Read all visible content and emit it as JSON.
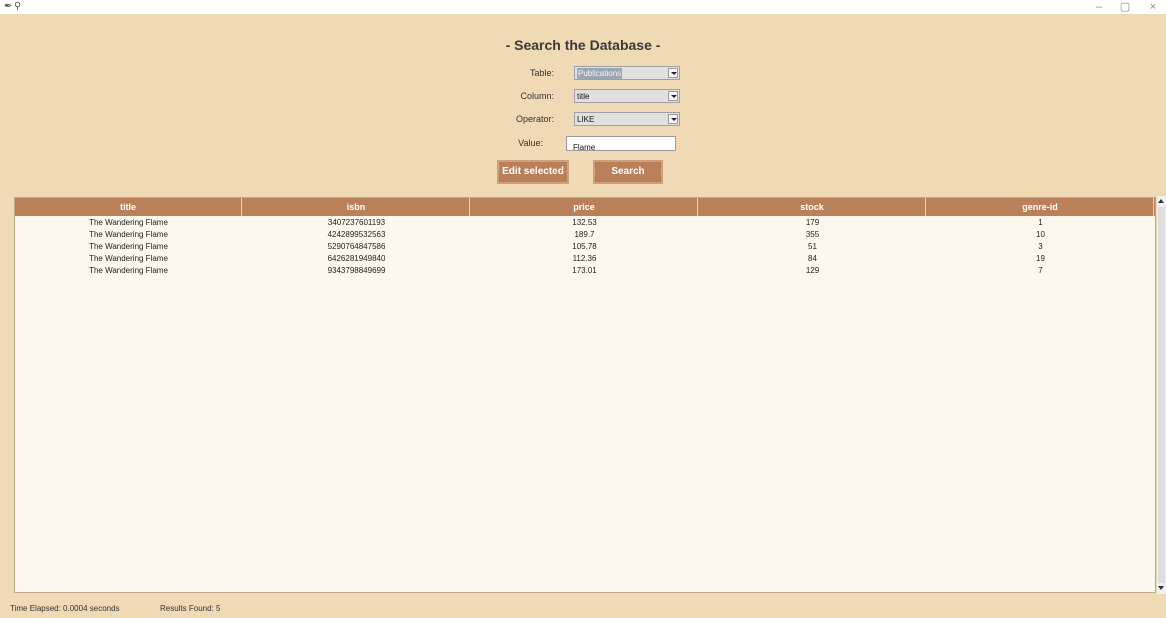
{
  "window": {
    "minimize": "–",
    "maximize": "▢",
    "close": "×"
  },
  "heading": "- Search the Database -",
  "form": {
    "table_label": "Table:",
    "table_value": "Publications",
    "column_label": "Column:",
    "column_value": "title",
    "operator_label": "Operator:",
    "operator_value": "LIKE",
    "value_label": "Value:",
    "value_value": "Flame"
  },
  "buttons": {
    "edit_label": "Edit selected",
    "search_label": "Search"
  },
  "table": {
    "columns": [
      "title",
      "isbn",
      "price",
      "stock",
      "genre-id"
    ],
    "rows": [
      [
        "The Wandering Flame",
        "3407237601193",
        "132.53",
        "179",
        "1"
      ],
      [
        "The Wandering Flame",
        "4242899532563",
        "189.7",
        "355",
        "10"
      ],
      [
        "The Wandering Flame",
        "5290764847586",
        "105.78",
        "51",
        "3"
      ],
      [
        "The Wandering Flame",
        "6426281949840",
        "112.36",
        "84",
        "19"
      ],
      [
        "The Wandering Flame",
        "9343798849699",
        "173.01",
        "129",
        "7"
      ]
    ]
  },
  "status": {
    "time_elapsed": "Time Elapsed: 0.0004 seconds",
    "results_found": "Results Found: 5"
  },
  "colors": {
    "background": "#f0d9b5",
    "accent": "#b9805a",
    "table_bg": "#fdf8ed"
  }
}
